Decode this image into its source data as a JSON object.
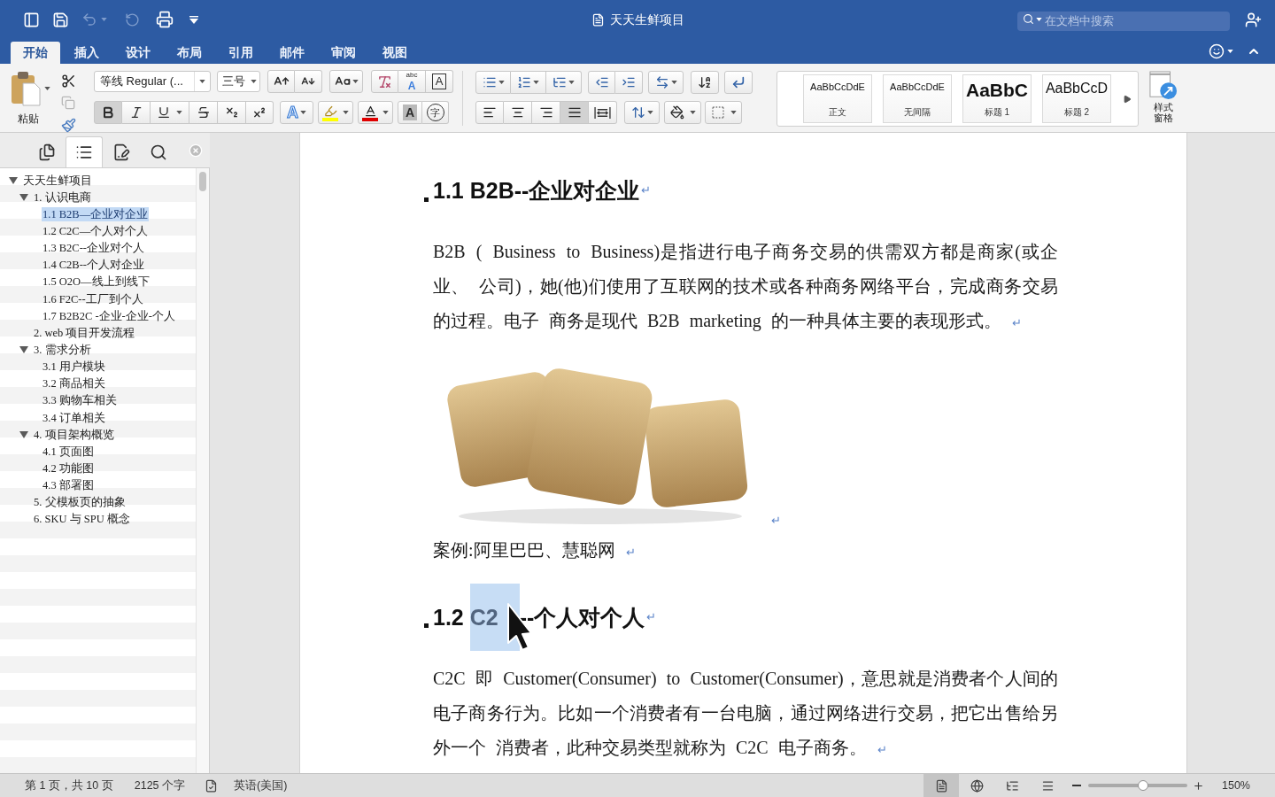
{
  "window": {
    "title": "天天生鲜项目"
  },
  "quick_access": {
    "undo_disabled": true,
    "redo_disabled": true
  },
  "search": {
    "placeholder": "在文档中搜索"
  },
  "tabs": [
    {
      "label": "开始",
      "selected": true
    },
    {
      "label": "插入",
      "selected": false
    },
    {
      "label": "设计",
      "selected": false
    },
    {
      "label": "布局",
      "selected": false
    },
    {
      "label": "引用",
      "selected": false
    },
    {
      "label": "邮件",
      "selected": false
    },
    {
      "label": "审阅",
      "selected": false
    },
    {
      "label": "视图",
      "selected": false
    }
  ],
  "ribbon": {
    "paste_label": "粘贴",
    "copy_disabled": true,
    "font_name": "等线 Regular (...",
    "font_size": "三号",
    "char_format": [
      {
        "kind": "bold",
        "on": true
      },
      {
        "kind": "italic",
        "on": false
      },
      {
        "kind": "underline",
        "on": false
      },
      {
        "kind": "strikethrough",
        "on": false
      },
      {
        "kind": "subscript",
        "on": false
      },
      {
        "kind": "superscript",
        "on": false
      }
    ],
    "glyphs": {
      "text_effects": "A",
      "phonetic_top": "abc",
      "phonetic_bottom": "A",
      "char_border": "A",
      "char_shading": "A",
      "enclose": "字"
    },
    "alignment": [
      {
        "kind": "left",
        "selected": false
      },
      {
        "kind": "center",
        "selected": false
      },
      {
        "kind": "right",
        "selected": false
      },
      {
        "kind": "justify",
        "selected": true
      },
      {
        "kind": "distributed",
        "selected": false
      }
    ],
    "styles": [
      {
        "kind": "body",
        "preview": "AaBbCcDdE",
        "name": "正文"
      },
      {
        "kind": "body",
        "preview": "AaBbCcDdE",
        "name": "无间隔"
      },
      {
        "kind": "heading1",
        "preview": "AaBbC",
        "name": "标题 1"
      },
      {
        "kind": "heading2",
        "preview": "AaBbCcD",
        "name": "标题 2"
      }
    ],
    "styles_pane_label": "样式窗格"
  },
  "navigation": {
    "tabs": [
      {
        "kind": "pages",
        "selected": false
      },
      {
        "kind": "outline",
        "selected": true
      },
      {
        "kind": "edit",
        "selected": false
      },
      {
        "kind": "search",
        "selected": false
      }
    ],
    "outline": [
      {
        "label": "天天生鲜项目",
        "expanded": true,
        "selected": false,
        "children": [
          {
            "label": "1. 认识电商",
            "expanded": true,
            "selected": false,
            "children": [
              {
                "label": "1.1 B2B—企业对企业",
                "selected": true
              },
              {
                "label": "1.2 C2C—个人对个人",
                "selected": false
              },
              {
                "label": "1.3 B2C--企业对个人",
                "selected": false
              },
              {
                "label": "1.4 C2B--个人对企业",
                "selected": false
              },
              {
                "label": "1.5 O2O—线上到线下",
                "selected": false
              },
              {
                "label": "1.6 F2C--工厂到个人",
                "selected": false
              },
              {
                "label": "1.7 B2B2C -企业-企业-个人",
                "selected": false
              }
            ]
          },
          {
            "label": "2. web 项目开发流程",
            "selected": false
          },
          {
            "label": "3. 需求分析",
            "expanded": true,
            "selected": false,
            "children": [
              {
                "label": "3.1 用户模块",
                "selected": false
              },
              {
                "label": "3.2 商品相关",
                "selected": false
              },
              {
                "label": "3.3 购物车相关",
                "selected": false
              },
              {
                "label": "3.4 订单相关",
                "selected": false
              }
            ]
          },
          {
            "label": "4. 项目架构概览",
            "expanded": true,
            "selected": false,
            "children": [
              {
                "label": "4.1 页面图",
                "selected": false
              },
              {
                "label": "4.2 功能图",
                "selected": false
              },
              {
                "label": "4.3 部署图",
                "selected": false
              }
            ]
          },
          {
            "label": "5. 父模板页的抽象",
            "selected": false
          },
          {
            "label": "6. SKU 与 SPU 概念",
            "selected": false
          }
        ]
      }
    ]
  },
  "document": {
    "blocks": [
      {
        "kind": "heading",
        "segments": [
          {
            "text": "1.1 B2B--企业对企业",
            "selected": false
          }
        ],
        "end_mark": "↵"
      },
      {
        "kind": "paragraph",
        "text": "B2B ( Business to Business)是指进行电子商务交易的供需双方都是商家(或企业、 公司)，她(他)们使用了互联网的技术或各种商务网络平台，完成商务交易的过程。电子 商务是现代 B2B marketing 的一种具体主要的表现形式。",
        "end_mark": "↵"
      },
      {
        "kind": "image",
        "end_mark": "↵"
      },
      {
        "kind": "paragraph",
        "text": "案例:阿里巴巴、慧聪网",
        "end_mark": "↵"
      },
      {
        "kind": "heading",
        "segments": [
          {
            "text": "1.2 ",
            "selected": false
          },
          {
            "text": "C2",
            "selected": true
          },
          {
            "text": "--个人对个人",
            "selected": false
          }
        ],
        "end_mark": "↵"
      },
      {
        "kind": "paragraph",
        "text": "C2C 即 Customer(Consumer) to Customer(Consumer)，意思就是消费者个人间的电子商务行为。比如一个消费者有一台电脑，通过网络进行交易，把它出售给另外一个 消费者，此种交易类型就称为 C2C 电子商务。",
        "end_mark": "↵"
      }
    ]
  },
  "status_bar": {
    "page": "第 1 页，共 10 页",
    "words": "2125 个字",
    "language": "英语(美国)",
    "views": [
      {
        "kind": "print",
        "selected": true
      },
      {
        "kind": "web",
        "selected": false
      },
      {
        "kind": "outline",
        "selected": false
      },
      {
        "kind": "draft",
        "selected": false
      }
    ],
    "zoom": {
      "level": 0.55,
      "reading": "150%"
    }
  }
}
